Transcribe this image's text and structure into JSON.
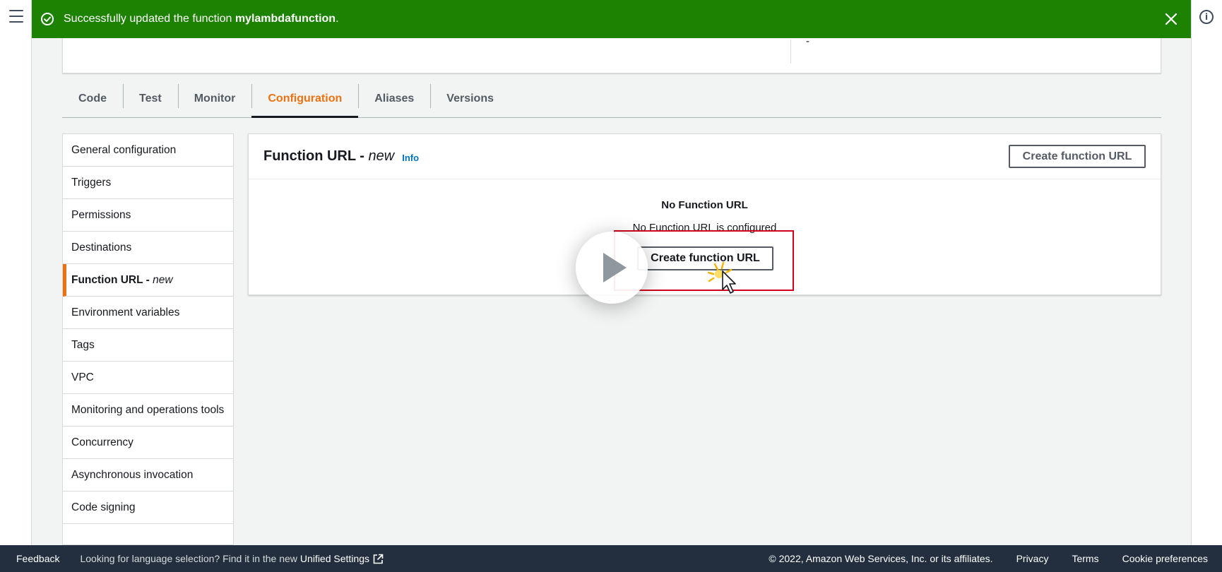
{
  "flash": {
    "message_prefix": "Successfully updated the function ",
    "function_name": "mylambdafunction",
    "message_suffix": ".",
    "color": "#1d8102"
  },
  "overview": {
    "value": "-"
  },
  "tabs": [
    {
      "label": "Code"
    },
    {
      "label": "Test"
    },
    {
      "label": "Monitor"
    },
    {
      "label": "Configuration",
      "active": true
    },
    {
      "label": "Aliases"
    },
    {
      "label": "Versions"
    }
  ],
  "sidebar": {
    "items": [
      {
        "label": "General configuration"
      },
      {
        "label": "Triggers"
      },
      {
        "label": "Permissions"
      },
      {
        "label": "Destinations"
      },
      {
        "label": "Function URL - ",
        "suffix": "new",
        "active": true
      },
      {
        "label": "Environment variables"
      },
      {
        "label": "Tags"
      },
      {
        "label": "VPC"
      },
      {
        "label": "Monitoring and operations tools"
      },
      {
        "label": "Concurrency"
      },
      {
        "label": "Asynchronous invocation"
      },
      {
        "label": "Code signing"
      }
    ]
  },
  "panel": {
    "title": "Function URL - ",
    "title_suffix": "new",
    "info_label": "Info",
    "header_button": "Create function URL",
    "empty_title": "No Function URL",
    "empty_description": "No Function URL is configured",
    "empty_button": "Create function URL"
  },
  "footer": {
    "feedback": "Feedback",
    "language_prompt": "Looking for language selection? Find it in the new",
    "unified_settings": "Unified Settings",
    "copyright": "© 2022, Amazon Web Services, Inc. or its affiliates.",
    "privacy": "Privacy",
    "terms": "Terms",
    "cookie_preferences": "Cookie preferences"
  },
  "colors": {
    "accent": "#ec7211",
    "link": "#0073bb",
    "footer_bg": "#232f3e",
    "highlight": "#d0021b"
  },
  "icons": [
    "menu-icon",
    "info-circle-icon",
    "check-circle-icon",
    "close-icon",
    "play-icon",
    "cursor-icon",
    "external-link-icon"
  ]
}
